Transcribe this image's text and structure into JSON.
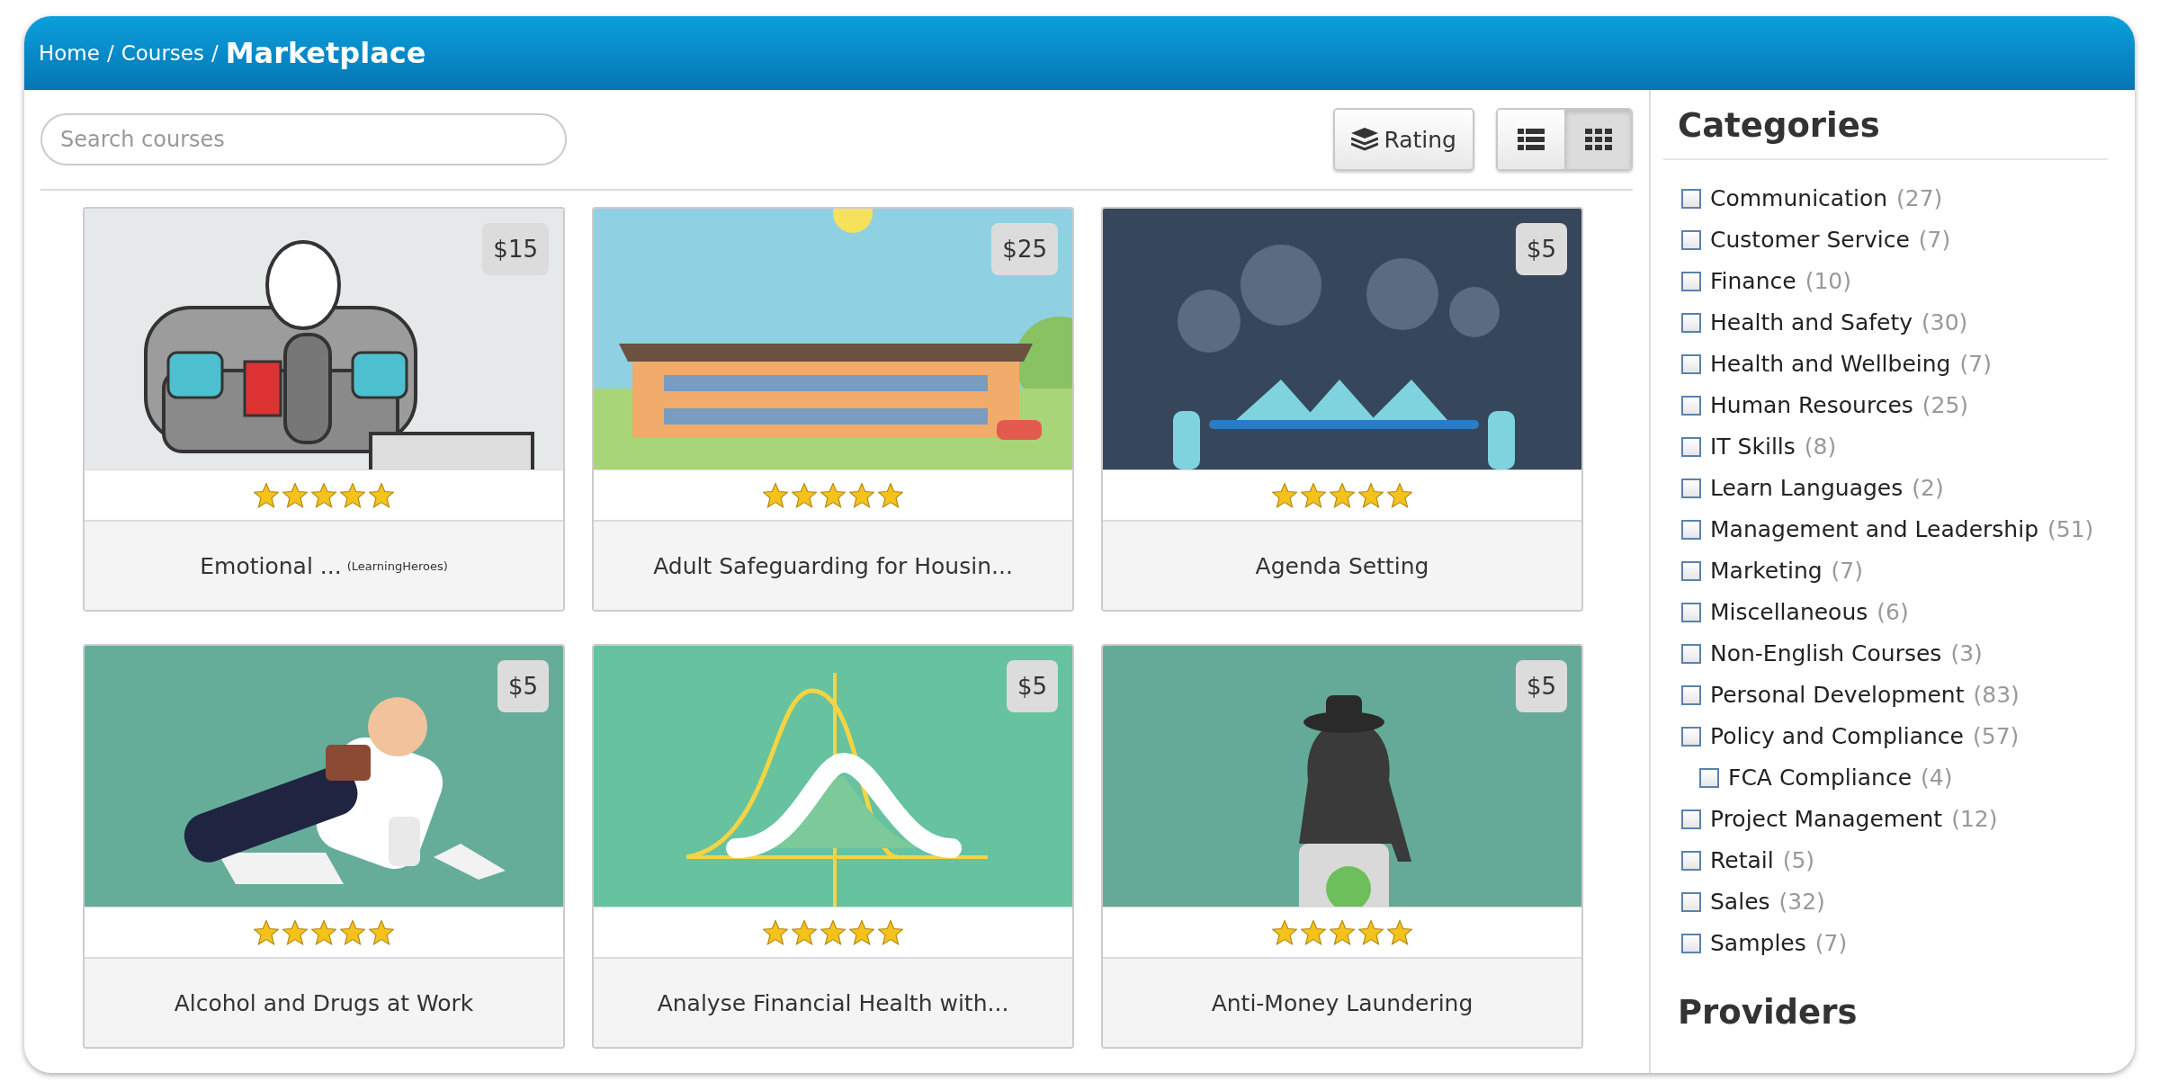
{
  "header": {
    "breadcrumb": [
      "Home",
      "Courses"
    ],
    "separator": "/",
    "current": "Marketplace"
  },
  "toolbar": {
    "search": {
      "placeholder": "Search courses"
    },
    "sort_button": {
      "label": "Rating"
    },
    "views": [
      {
        "kind": "list",
        "selected": false
      },
      {
        "kind": "grid",
        "selected": true
      }
    ]
  },
  "courses": [
    {
      "title": "Emotional ...",
      "provider": "(LearningHeroes)",
      "price": "$15",
      "stars": 5
    },
    {
      "title": "Adult Safeguarding for Housin...",
      "price": "$25",
      "stars": 5
    },
    {
      "title": "Agenda Setting",
      "price": "$5",
      "stars": 5
    },
    {
      "title": "Alcohol and Drugs at Work",
      "price": "$5",
      "stars": 5
    },
    {
      "title": "Analyse Financial Health with...",
      "price": "$5",
      "stars": 5
    },
    {
      "title": "Anti-Money Laundering",
      "price": "$5",
      "stars": 5
    }
  ],
  "sidebar": {
    "categories_title": "Categories",
    "categories": [
      {
        "label": "Communication",
        "count": "(27)",
        "checked": false
      },
      {
        "label": "Customer Service",
        "count": "(7)",
        "checked": false
      },
      {
        "label": "Finance",
        "count": "(10)",
        "checked": false
      },
      {
        "label": "Health and Safety",
        "count": "(30)",
        "checked": false
      },
      {
        "label": "Health and Wellbeing",
        "count": "(7)",
        "checked": false
      },
      {
        "label": "Human Resources",
        "count": "(25)",
        "checked": false
      },
      {
        "label": "IT Skills",
        "count": "(8)",
        "checked": false
      },
      {
        "label": "Learn Languages",
        "count": "(2)",
        "checked": false
      },
      {
        "label": "Management and Leadership",
        "count": "(51)",
        "checked": false
      },
      {
        "label": "Marketing",
        "count": "(7)",
        "checked": false
      },
      {
        "label": "Miscellaneous",
        "count": "(6)",
        "checked": false
      },
      {
        "label": "Non-English Courses",
        "count": "(3)",
        "checked": false
      },
      {
        "label": "Personal Development",
        "count": "(83)",
        "checked": false
      },
      {
        "label": "Policy and Compliance",
        "count": "(57)",
        "checked": false,
        "children": [
          {
            "label": "FCA Compliance",
            "count": "(4)",
            "checked": false
          }
        ]
      },
      {
        "label": "Project Management",
        "count": "(12)",
        "checked": false
      },
      {
        "label": "Retail",
        "count": "(5)",
        "checked": false
      },
      {
        "label": "Sales",
        "count": "(32)",
        "checked": false
      },
      {
        "label": "Samples",
        "count": "(7)",
        "checked": false
      }
    ],
    "providers_title": "Providers"
  }
}
